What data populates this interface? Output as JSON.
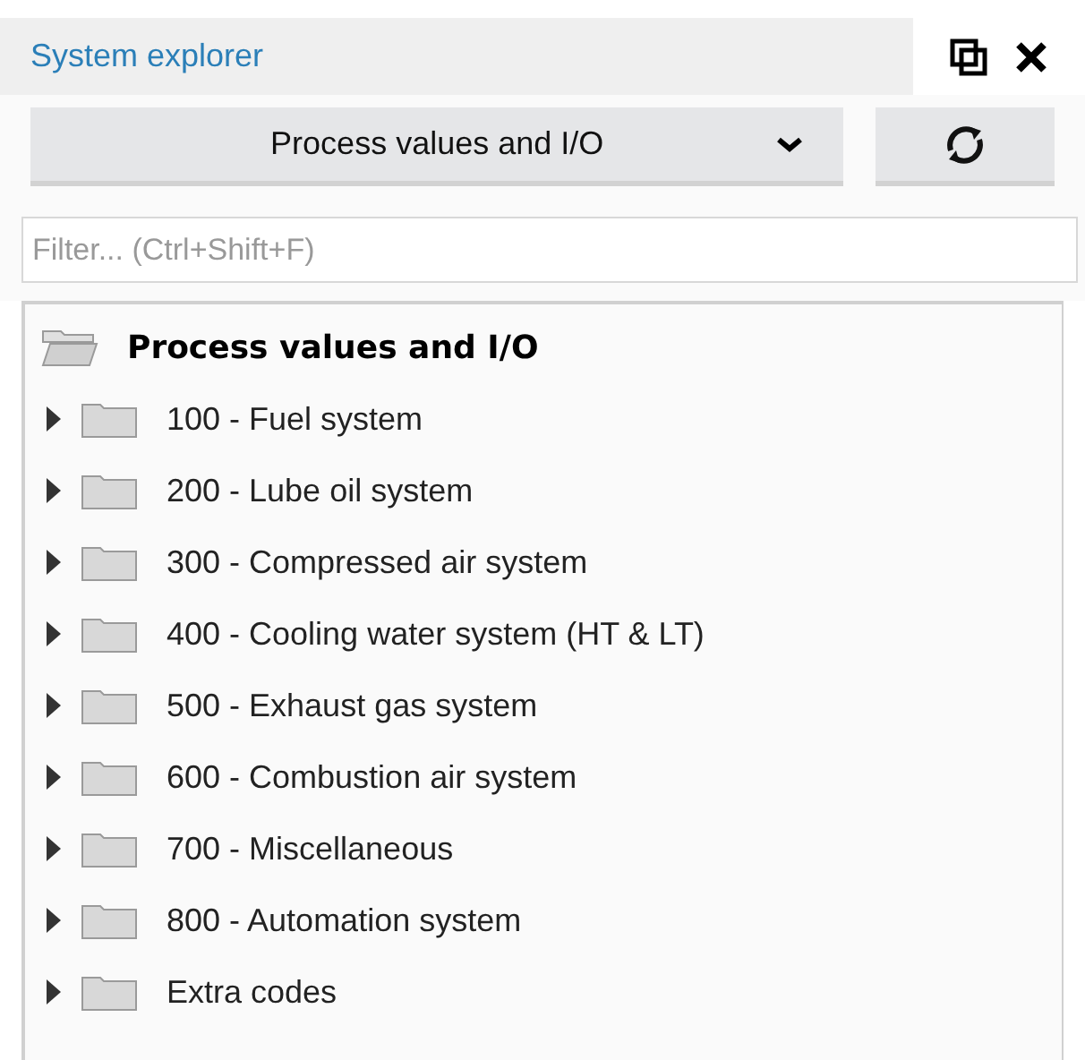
{
  "panel": {
    "title": "System explorer"
  },
  "selector": {
    "value": "Process values and I/O"
  },
  "filter": {
    "placeholder": "Filter... (Ctrl+Shift+F)"
  },
  "tree": {
    "label": "Process values and I/O",
    "expanded": true,
    "children": [
      {
        "label": "100 - Fuel system",
        "expanded": false
      },
      {
        "label": "200 - Lube oil system",
        "expanded": false
      },
      {
        "label": "300 - Compressed air system",
        "expanded": false
      },
      {
        "label": "400 - Cooling water system (HT & LT)",
        "expanded": false
      },
      {
        "label": "500 - Exhaust gas system",
        "expanded": false
      },
      {
        "label": "600 - Combustion air system",
        "expanded": false
      },
      {
        "label": "700 - Miscellaneous",
        "expanded": false
      },
      {
        "label": "800 - Automation system",
        "expanded": false
      },
      {
        "label": "Extra codes",
        "expanded": false
      }
    ]
  }
}
